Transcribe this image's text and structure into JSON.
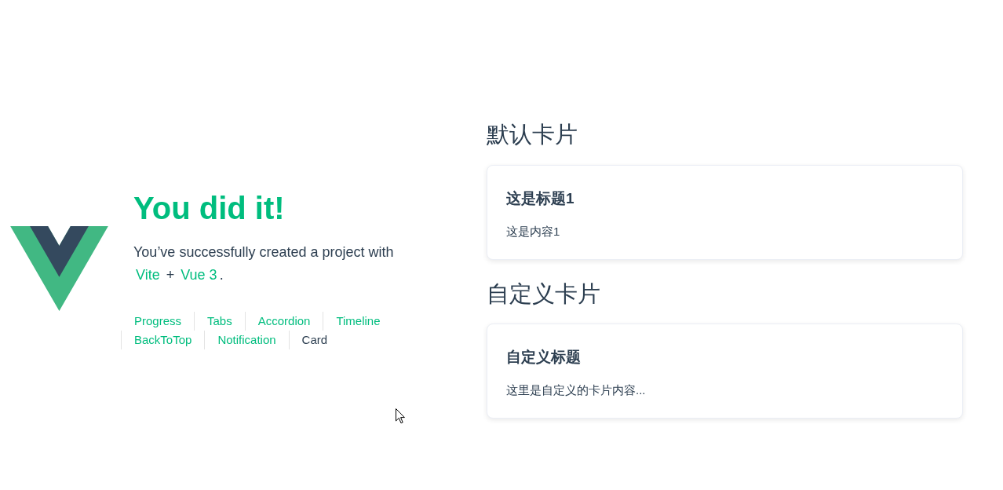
{
  "header": {
    "title": "You did it!",
    "greeting": [
      {
        "kind": "text",
        "text": "You’ve successfully created a project with"
      },
      {
        "kind": "link",
        "text": "Vite"
      },
      {
        "kind": "text",
        "text": "+"
      },
      {
        "kind": "link",
        "text": "Vue 3"
      },
      {
        "kind": "text",
        "text": "."
      }
    ],
    "nav": [
      {
        "label": "Progress",
        "selected": false
      },
      {
        "label": "Tabs",
        "selected": false
      },
      {
        "label": "Accordion",
        "selected": false
      },
      {
        "label": "Timeline",
        "selected": false
      },
      {
        "label": "BackToTop",
        "selected": false
      },
      {
        "label": "Notification",
        "selected": false
      },
      {
        "label": "Card",
        "selected": true
      }
    ]
  },
  "sections": [
    {
      "heading": "默认卡片",
      "card": {
        "title": "这是标题1",
        "content": "这是内容1"
      }
    },
    {
      "heading": "自定义卡片",
      "card": {
        "title": "自定义标题",
        "content": "这里是自定义的卡片内容..."
      }
    }
  ]
}
